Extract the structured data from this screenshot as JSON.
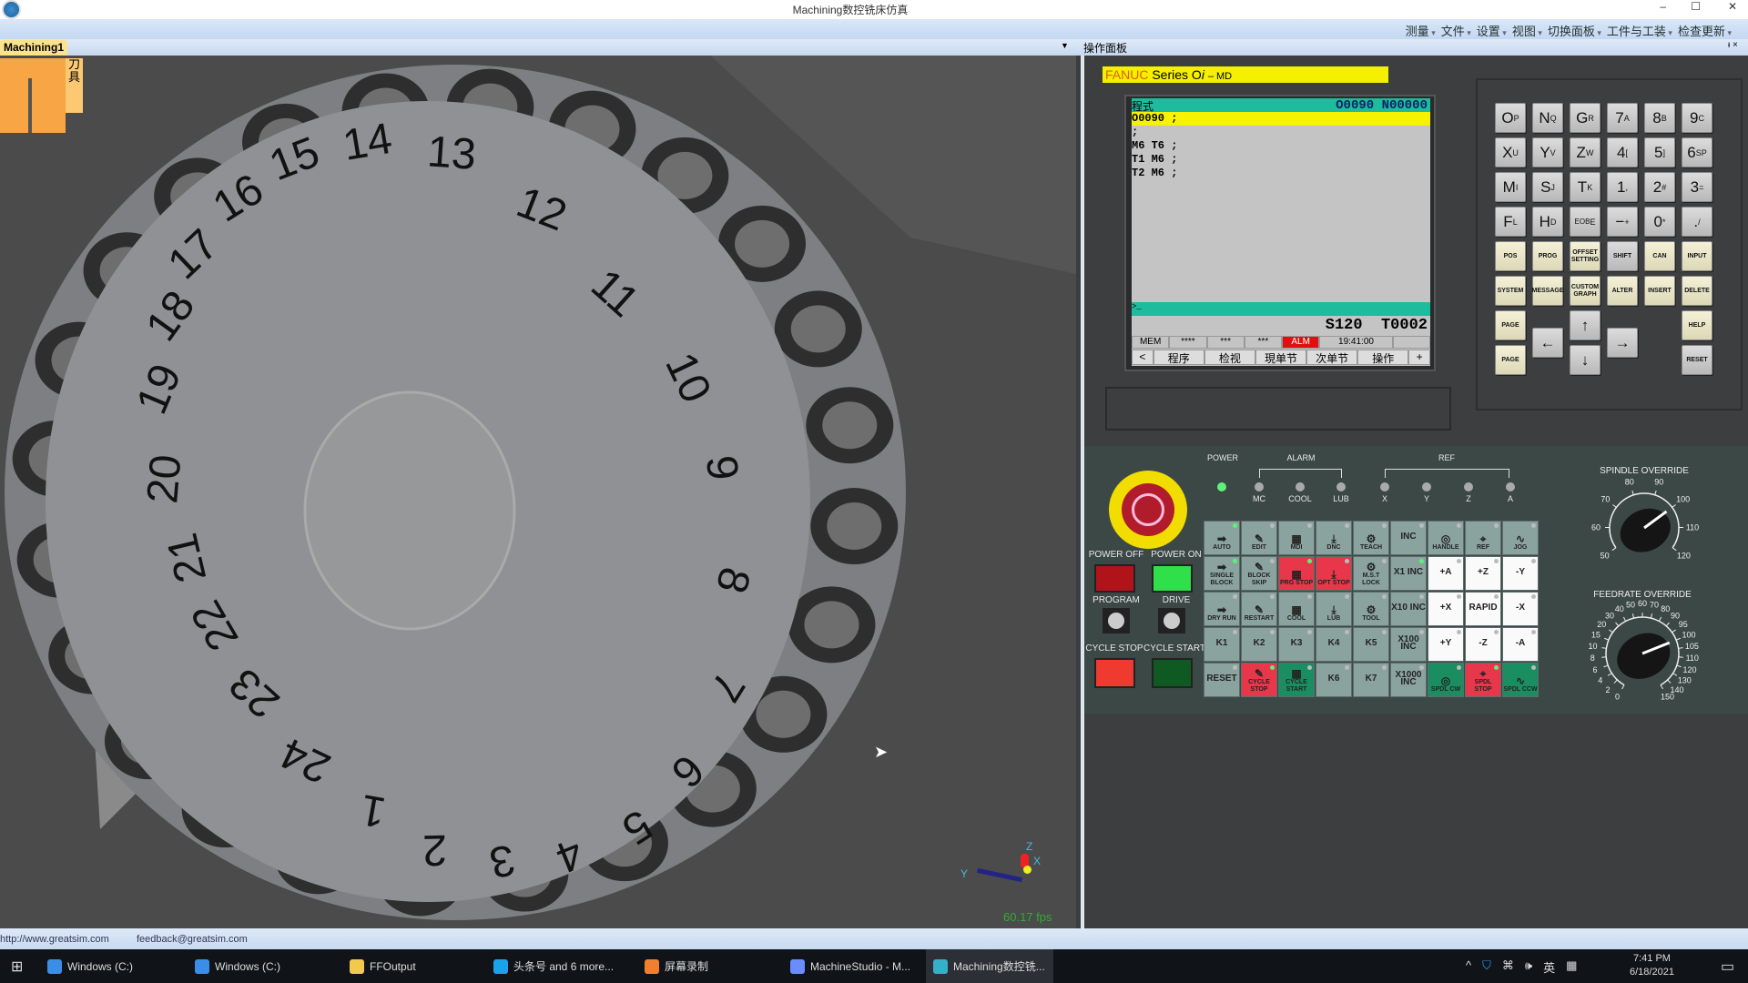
{
  "window": {
    "title": "Machining数控铣床仿真"
  },
  "menu": [
    "测量",
    "文件",
    "设置",
    "视图",
    "切换面板",
    "工件与工装",
    "检查更新"
  ],
  "tabs": {
    "left": "Machining1",
    "right": "操作面板"
  },
  "tool_panel": {
    "label": "刀具"
  },
  "viewport": {
    "fps": "60.17 fps",
    "axes": {
      "x": "X",
      "y": "Y",
      "z": "Z"
    },
    "magazine_numbers": [
      "1",
      "2",
      "3",
      "4",
      "5",
      "6",
      "7",
      "8",
      "9",
      "10",
      "11",
      "12",
      "13",
      "14",
      "15",
      "16",
      "17",
      "18",
      "19",
      "20",
      "21",
      "22",
      "23",
      "24"
    ]
  },
  "cnc": {
    "brand": "FANUC",
    "series": "Series O",
    "series_i": "i",
    "model": "– MD",
    "screen": {
      "mode": "程式",
      "program": "O0090",
      "seq": "N00000",
      "lines": [
        "O0090 ;",
        ";",
        "M6 T6 ;",
        "T1 M6 ;",
        "T2 M6 ;"
      ],
      "input": ">_",
      "spindle": "S120",
      "tool": "T0002",
      "status": [
        "MEM",
        "****",
        "***",
        "***",
        "ALM",
        "19:41:00",
        ""
      ],
      "softkeys": [
        "<",
        "程序",
        "检视",
        "現单节",
        "次单节",
        "操作",
        "+"
      ]
    },
    "keys": [
      [
        "O",
        "P"
      ],
      [
        "N",
        "Q"
      ],
      [
        "G",
        "R"
      ],
      [
        "7",
        "A"
      ],
      [
        "8",
        "B"
      ],
      [
        "9",
        "C"
      ],
      [
        "X",
        "U"
      ],
      [
        "Y",
        "V"
      ],
      [
        "Z",
        "W"
      ],
      [
        "4",
        "["
      ],
      [
        "5",
        "]"
      ],
      [
        "6",
        "SP"
      ],
      [
        "M",
        "I"
      ],
      [
        "S",
        "J"
      ],
      [
        "T",
        "K"
      ],
      [
        "1",
        ","
      ],
      [
        "2",
        "#"
      ],
      [
        "3",
        "="
      ],
      [
        "F",
        "L"
      ],
      [
        "H",
        "D"
      ],
      [
        "EOB",
        "E"
      ],
      [
        "−",
        "+"
      ],
      [
        "0",
        "*"
      ],
      [
        ".",
        "/"
      ]
    ],
    "func_keys": [
      "POS",
      "PROG",
      "OFFSET SETTING",
      "SHIFT",
      "CAN",
      "INPUT",
      "SYSTEM",
      "MESSAGE",
      "CUSTOM GRAPH",
      "ALTER",
      "INSERT",
      "DELETE"
    ],
    "nav_keys": {
      "page_up": "PAGE",
      "page_down": "PAGE",
      "left": "←",
      "up": "↑",
      "right": "→",
      "down": "↓",
      "help": "HELP",
      "reset": "RESET"
    },
    "softkey_arrows": {
      "left": "◀",
      "right": "▶"
    }
  },
  "operator": {
    "indicators": {
      "power": "POWER",
      "alarm": "ALARM",
      "ref": "REF",
      "alarm_items": [
        "MC",
        "COOL",
        "LUB"
      ],
      "ref_items": [
        "X",
        "Y",
        "Z",
        "A"
      ]
    },
    "buttons": {
      "power_off": "POWER OFF",
      "power_on": "POWER ON",
      "program": "PROGRAM",
      "drive": "DRIVE",
      "cycle_stop": "CYCLE STOP",
      "cycle_start": "CYCLE START"
    },
    "grid": [
      [
        "AUTO",
        "EDIT",
        "MDI",
        "DNC",
        "TEACH",
        "INC",
        "HANDLE",
        "REF",
        "JOG"
      ],
      [
        "SINGLE BLOCK",
        "BLOCK SKIP",
        "PRG STOP",
        "OPT STOP",
        "M.S.T LOCK",
        "X1 INC",
        "+A",
        "+Z",
        "-Y"
      ],
      [
        "DRY RUN",
        "RESTART",
        "COOL",
        "LUB",
        "TOOL",
        "X10 INC",
        "+X",
        "RAPID",
        "-X"
      ],
      [
        "K1",
        "K2",
        "K3",
        "K4",
        "K5",
        "X100 INC",
        "+Y",
        "-Z",
        "-A"
      ],
      [
        "RESET",
        "CYCLE STOP",
        "CYCLE START",
        "K6",
        "K7",
        "X1000 INC",
        "SPDL CW",
        "SPDL STOP",
        "SPDL CCW"
      ]
    ],
    "spindle_override": {
      "label": "SPINDLE OVERRIDE",
      "ticks": [
        "50",
        "60",
        "70",
        "80",
        "90",
        "100",
        "110",
        "120"
      ],
      "value": 100
    },
    "feedrate_override": {
      "label": "FEEDRATE OVERRIDE",
      "ticks": [
        "0",
        "2",
        "4",
        "6",
        "8",
        "10",
        "15",
        "20",
        "30",
        "40",
        "50",
        "60",
        "70",
        "80",
        "90",
        "95",
        "100",
        "105",
        "110",
        "120",
        "130",
        "140",
        "150"
      ],
      "value": 100
    }
  },
  "statusbar": {
    "url": "http://www.greatsim.com",
    "feedback": "feedback@greatsim.com"
  },
  "taskbar": {
    "items": [
      "Windows (C:)",
      "Windows (C:)",
      "FFOutput",
      "头条号 and 6 more...",
      "屏幕录制",
      "MachineStudio - M...",
      "Machining数控铣..."
    ],
    "time": "7:41 PM",
    "date": "6/18/2021",
    "ime": "英"
  }
}
